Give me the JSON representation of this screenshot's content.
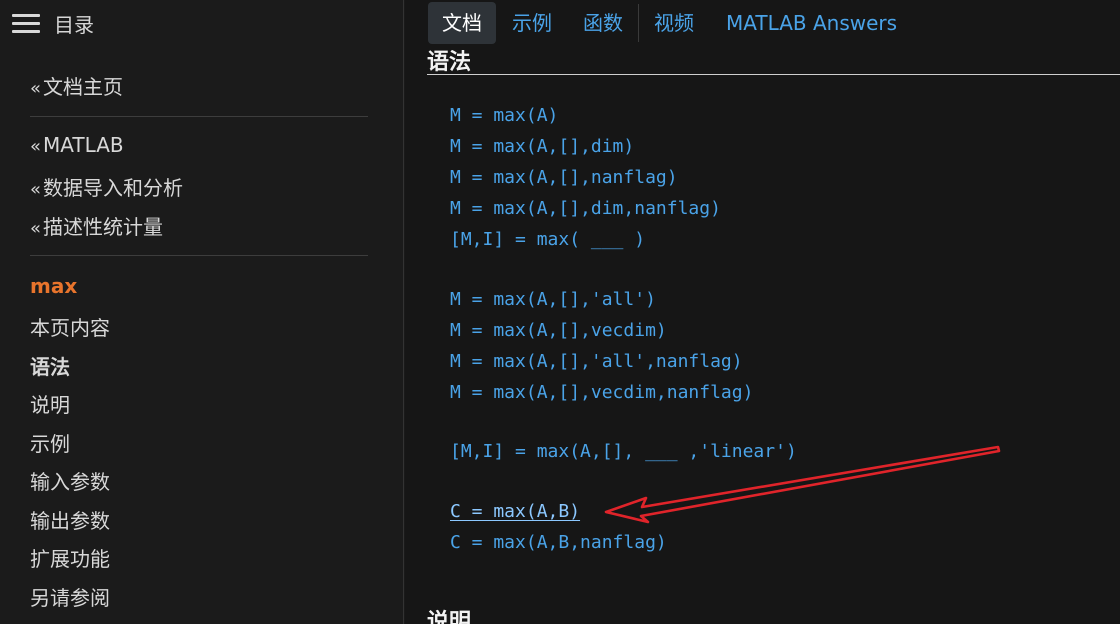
{
  "sidebar": {
    "toc_title": "目录",
    "breadcrumbs": [
      {
        "prefix": "«",
        "label": "文档主页"
      },
      {
        "prefix": "«",
        "label": "MATLAB"
      },
      {
        "prefix": "«",
        "label": "数据导入和分析"
      },
      {
        "prefix": "«",
        "label": "描述性统计量"
      }
    ],
    "current_page": "max",
    "items": [
      {
        "label": "本页内容"
      },
      {
        "label": "语法"
      },
      {
        "label": "说明"
      },
      {
        "label": "示例"
      },
      {
        "label": "输入参数"
      },
      {
        "label": "输出参数"
      },
      {
        "label": "扩展功能"
      },
      {
        "label": "另请参阅"
      }
    ]
  },
  "tabs": [
    {
      "label": "文档",
      "active": true
    },
    {
      "label": "示例"
    },
    {
      "label": "函数"
    },
    {
      "label": "视频"
    },
    {
      "label": "MATLAB Answers"
    }
  ],
  "main": {
    "syntax_heading": "语法",
    "next_heading": "说明",
    "syntax_lines": [
      "M = max(A)",
      "M = max(A,[],dim)",
      "M = max(A,[],nanflag)",
      "M = max(A,[],dim,nanflag)",
      "[M,I] = max( ___ )",
      "M = max(A,[],'all')",
      "M = max(A,[],vecdim)",
      "M = max(A,[],'all',nanflag)",
      "M = max(A,[],vecdim,nanflag)",
      "[M,I] = max(A,[], ___ ,'linear')",
      "C = max(A,B)",
      "C = max(A,B,nanflag)"
    ]
  },
  "annotation": {
    "arrow_color": "#e0242a"
  },
  "colors": {
    "link": "#4aa3e8",
    "current_page": "#e8742c",
    "active_tab_bg": "#2e3338"
  }
}
